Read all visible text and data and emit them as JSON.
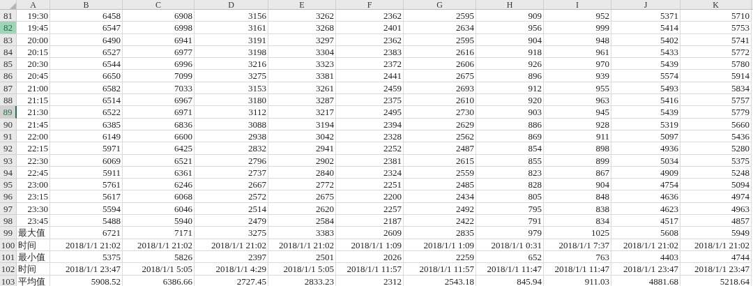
{
  "columns": [
    "A",
    "B",
    "C",
    "D",
    "E",
    "F",
    "G",
    "H",
    "I",
    "J",
    "K"
  ],
  "rows": [
    {
      "header": "81",
      "selected": false,
      "active": false,
      "kind": "time",
      "cells": [
        "19:30",
        "6458",
        "6908",
        "3156",
        "3262",
        "2362",
        "2595",
        "909",
        "952",
        "5371",
        "5710"
      ]
    },
    {
      "header": "82",
      "selected": true,
      "active": false,
      "kind": "time",
      "cells": [
        "19:45",
        "6547",
        "6998",
        "3161",
        "3268",
        "2401",
        "2634",
        "956",
        "999",
        "5414",
        "5753"
      ]
    },
    {
      "header": "83",
      "selected": false,
      "active": false,
      "kind": "time",
      "cells": [
        "20:00",
        "6490",
        "6941",
        "3191",
        "3297",
        "2362",
        "2595",
        "904",
        "948",
        "5402",
        "5741"
      ]
    },
    {
      "header": "84",
      "selected": false,
      "active": false,
      "kind": "time",
      "cells": [
        "20:15",
        "6527",
        "6977",
        "3198",
        "3304",
        "2383",
        "2616",
        "918",
        "961",
        "5433",
        "5772"
      ]
    },
    {
      "header": "85",
      "selected": false,
      "active": false,
      "kind": "time",
      "cells": [
        "20:30",
        "6544",
        "6996",
        "3216",
        "3323",
        "2372",
        "2606",
        "926",
        "970",
        "5439",
        "5780"
      ]
    },
    {
      "header": "86",
      "selected": false,
      "active": false,
      "kind": "time",
      "cells": [
        "20:45",
        "6650",
        "7099",
        "3275",
        "3381",
        "2441",
        "2675",
        "896",
        "939",
        "5574",
        "5914"
      ]
    },
    {
      "header": "87",
      "selected": false,
      "active": false,
      "kind": "time",
      "cells": [
        "21:00",
        "6582",
        "7033",
        "3153",
        "3261",
        "2459",
        "2693",
        "912",
        "955",
        "5493",
        "5834"
      ]
    },
    {
      "header": "88",
      "selected": false,
      "active": false,
      "kind": "time",
      "cells": [
        "21:15",
        "6514",
        "6967",
        "3180",
        "3287",
        "2375",
        "2610",
        "920",
        "963",
        "5416",
        "5757"
      ]
    },
    {
      "header": "89",
      "selected": false,
      "active": true,
      "kind": "time",
      "cells": [
        "21:30",
        "6522",
        "6971",
        "3112",
        "3217",
        "2495",
        "2730",
        "903",
        "945",
        "5439",
        "5779"
      ]
    },
    {
      "header": "90",
      "selected": false,
      "active": false,
      "kind": "time",
      "cells": [
        "21:45",
        "6385",
        "6836",
        "3088",
        "3194",
        "2394",
        "2629",
        "886",
        "928",
        "5319",
        "5660"
      ]
    },
    {
      "header": "91",
      "selected": false,
      "active": false,
      "kind": "time",
      "cells": [
        "22:00",
        "6149",
        "6600",
        "2938",
        "3042",
        "2328",
        "2562",
        "869",
        "911",
        "5097",
        "5436"
      ]
    },
    {
      "header": "92",
      "selected": false,
      "active": false,
      "kind": "time",
      "cells": [
        "22:15",
        "5971",
        "6425",
        "2832",
        "2941",
        "2252",
        "2487",
        "854",
        "898",
        "4936",
        "5280"
      ]
    },
    {
      "header": "93",
      "selected": false,
      "active": false,
      "kind": "time",
      "cells": [
        "22:30",
        "6069",
        "6521",
        "2796",
        "2902",
        "2381",
        "2615",
        "855",
        "899",
        "5034",
        "5375"
      ]
    },
    {
      "header": "94",
      "selected": false,
      "active": false,
      "kind": "time",
      "cells": [
        "22:45",
        "5911",
        "6361",
        "2737",
        "2840",
        "2324",
        "2559",
        "823",
        "867",
        "4909",
        "5248"
      ]
    },
    {
      "header": "95",
      "selected": false,
      "active": false,
      "kind": "time",
      "cells": [
        "23:00",
        "5761",
        "6246",
        "2667",
        "2772",
        "2251",
        "2485",
        "828",
        "904",
        "4754",
        "5094"
      ]
    },
    {
      "header": "96",
      "selected": false,
      "active": false,
      "kind": "time",
      "cells": [
        "23:15",
        "5617",
        "6068",
        "2572",
        "2675",
        "2200",
        "2434",
        "805",
        "848",
        "4636",
        "4974"
      ]
    },
    {
      "header": "97",
      "selected": false,
      "active": false,
      "kind": "time",
      "cells": [
        "23:30",
        "5594",
        "6046",
        "2514",
        "2620",
        "2257",
        "2492",
        "795",
        "838",
        "4623",
        "4963"
      ]
    },
    {
      "header": "98",
      "selected": false,
      "active": false,
      "kind": "time",
      "cells": [
        "23:45",
        "5488",
        "5940",
        "2479",
        "2584",
        "2187",
        "2422",
        "791",
        "834",
        "4517",
        "4857"
      ]
    },
    {
      "header": "99",
      "selected": false,
      "active": false,
      "kind": "stat",
      "cells": [
        "最大值",
        "6721",
        "7171",
        "3275",
        "3383",
        "2609",
        "2835",
        "979",
        "1025",
        "5608",
        "5949"
      ]
    },
    {
      "header": "100",
      "selected": false,
      "active": false,
      "kind": "stat",
      "cells": [
        "时间",
        "2018/1/1 21:02",
        "2018/1/1 21:02",
        "2018/1/1 21:02",
        "2018/1/1 21:02",
        "2018/1/1 1:09",
        "2018/1/1 1:09",
        "2018/1/1 0:31",
        "2018/1/1 7:37",
        "2018/1/1 21:02",
        "2018/1/1 21:02"
      ]
    },
    {
      "header": "101",
      "selected": false,
      "active": false,
      "kind": "stat",
      "cells": [
        "最小值",
        "5375",
        "5826",
        "2397",
        "2501",
        "2026",
        "2259",
        "652",
        "763",
        "4403",
        "4744"
      ]
    },
    {
      "header": "102",
      "selected": false,
      "active": false,
      "kind": "stat",
      "cells": [
        "时间",
        "2018/1/1 23:47",
        "2018/1/1 5:05",
        "2018/1/1 4:29",
        "2018/1/1 5:05",
        "2018/1/1 11:57",
        "2018/1/1 11:57",
        "2018/1/1 11:47",
        "2018/1/1 11:47",
        "2018/1/1 23:47",
        "2018/1/1 23:47"
      ]
    },
    {
      "header": "103",
      "selected": false,
      "active": false,
      "kind": "stat",
      "cells": [
        "平均值",
        "5908.52",
        "6386.66",
        "2727.45",
        "2833.23",
        "2312",
        "2543.18",
        "845.94",
        "911.03",
        "4881.68",
        "5218.64"
      ]
    }
  ]
}
